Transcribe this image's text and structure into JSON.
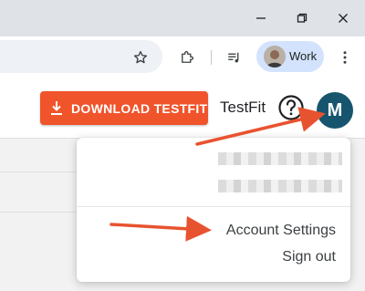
{
  "browser": {
    "profile": {
      "label": "Work"
    }
  },
  "header": {
    "download_label": "DOWNLOAD TESTFIT",
    "brand": "TestFit",
    "avatar_initial": "M"
  },
  "account_menu": {
    "items": [
      {
        "label": "Account Settings"
      },
      {
        "label": "Sign out"
      }
    ]
  },
  "colors": {
    "download_button": "#f0542b",
    "avatar": "#17556e",
    "annotation_arrow": "#e8532f",
    "profile_pill": "#d3e3fd"
  },
  "icons": [
    "minimize-icon",
    "restore-icon",
    "close-icon",
    "bookmark-star-icon",
    "extensions-icon",
    "media-controls-icon",
    "kebab-menu-icon",
    "download-icon",
    "help-icon"
  ]
}
